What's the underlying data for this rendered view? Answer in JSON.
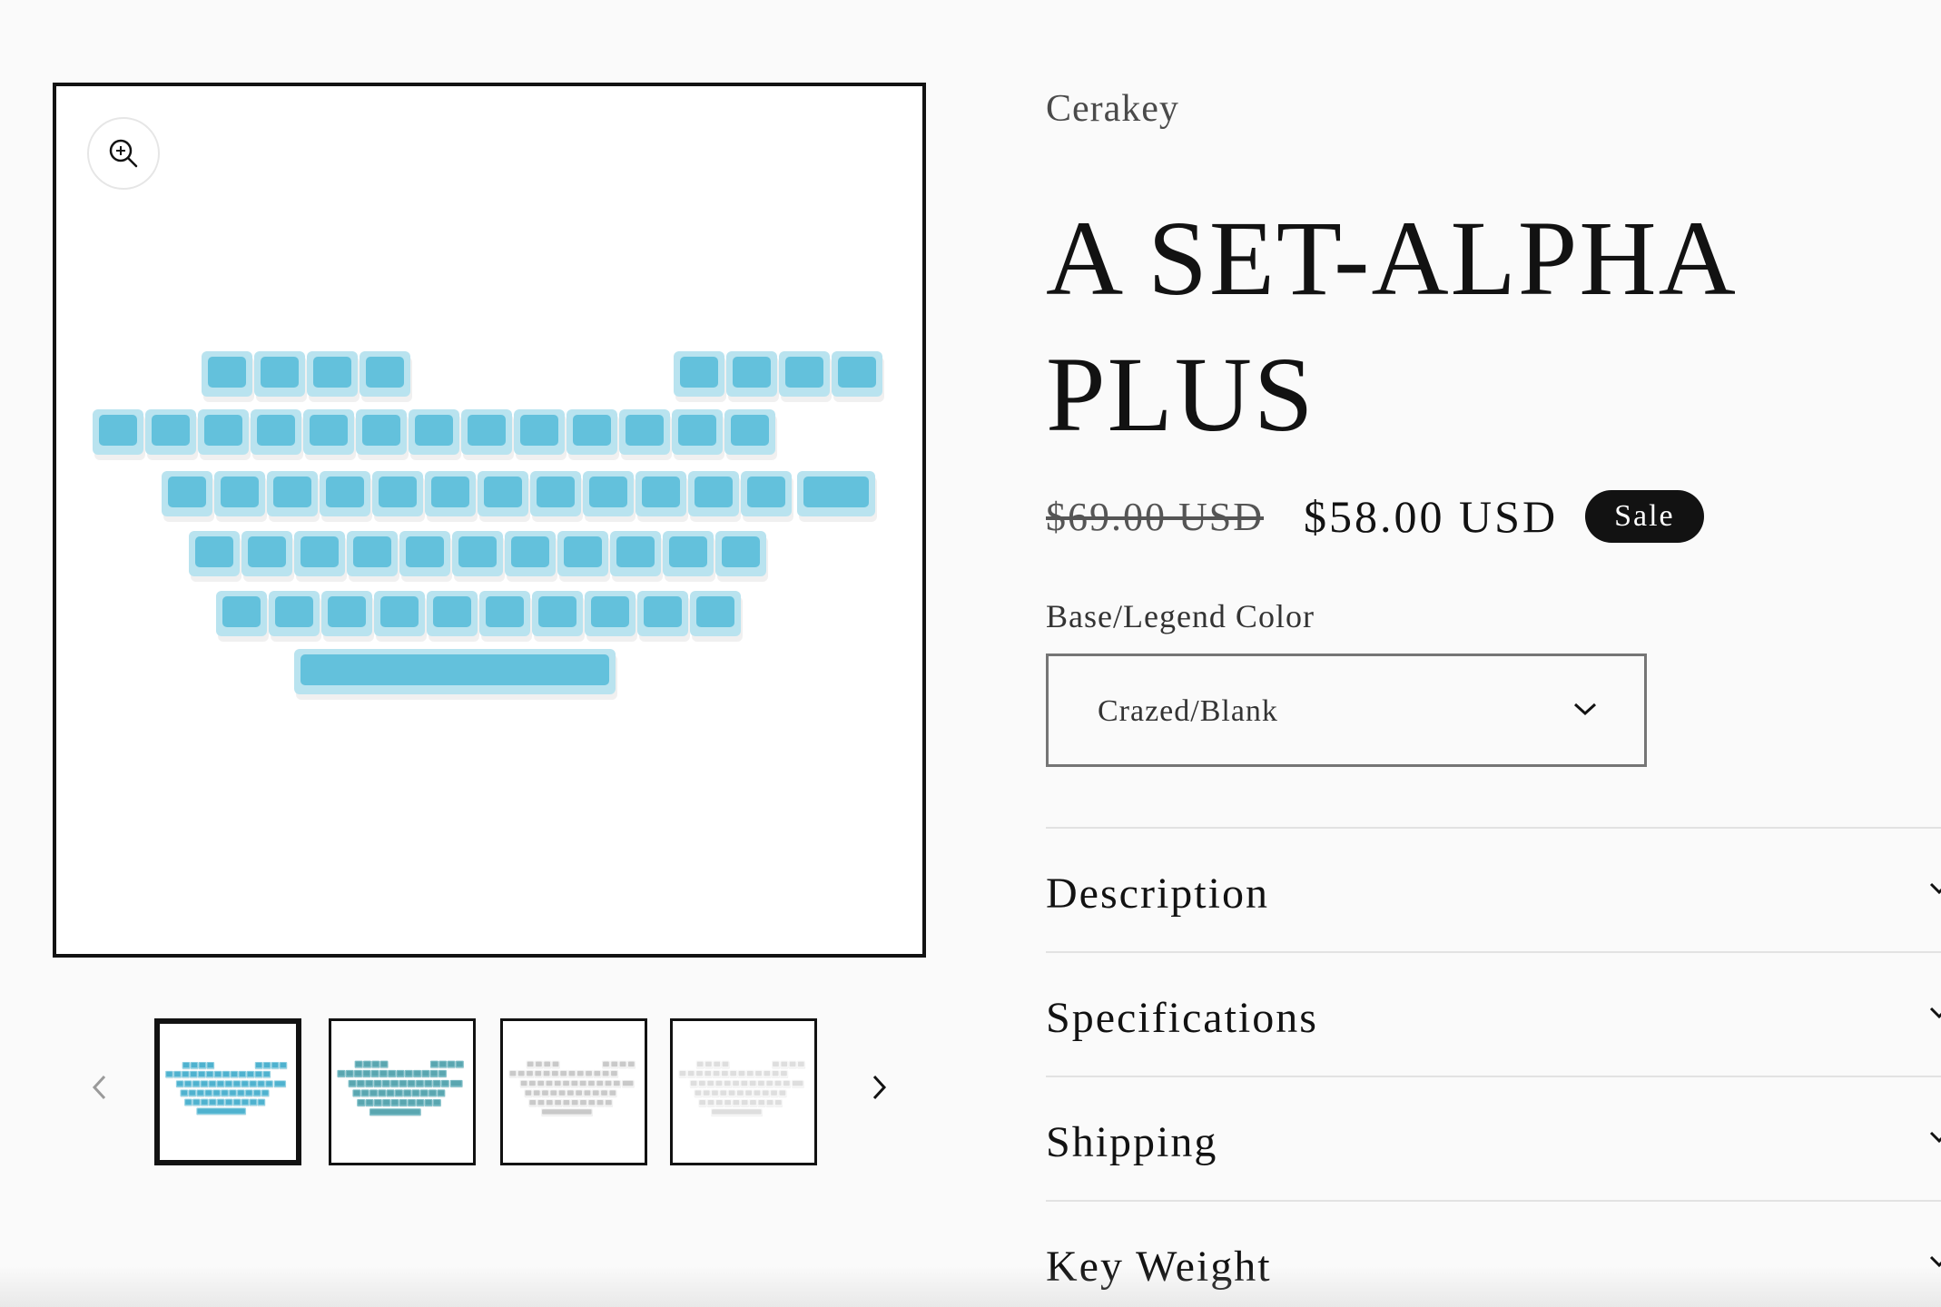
{
  "gallery": {
    "zoom_icon": "zoom-in-icon",
    "prev_icon": "chevron-left-icon",
    "next_icon": "chevron-right-icon",
    "thumbnails": [
      {
        "name": "thumbnail-crazed-blue",
        "active": true,
        "base": "#8fd0e2",
        "dark": "#4fb2cf"
      },
      {
        "name": "thumbnail-teal",
        "active": false,
        "base": "#7fbfc8",
        "dark": "#5aa6b0"
      },
      {
        "name": "thumbnail-white-legends",
        "active": false,
        "base": "#f2f2f2",
        "dark": "#c9c9c9"
      },
      {
        "name": "thumbnail-white-blank",
        "active": false,
        "base": "#f7f7f7",
        "dark": "#dedede"
      }
    ],
    "keycap_color": "#63c1dc",
    "keycap_edge": "#b9e3ef"
  },
  "product": {
    "vendor": "Cerakey",
    "title": "A SET-ALPHA PLUS",
    "price_regular": "$69.00 USD",
    "price_sale": "$58.00 USD",
    "sale_badge": "Sale",
    "variant_label": "Base/Legend Color",
    "variant_value": "Crazed/Blank",
    "variant_icon": "chevron-down-icon"
  },
  "accordion": [
    {
      "label": "Description"
    },
    {
      "label": "Specifications"
    },
    {
      "label": "Shipping"
    },
    {
      "label": "Key Weight"
    }
  ],
  "colors": {
    "text": "#121212",
    "badge_bg": "#121212",
    "badge_text": "#ffffff"
  }
}
